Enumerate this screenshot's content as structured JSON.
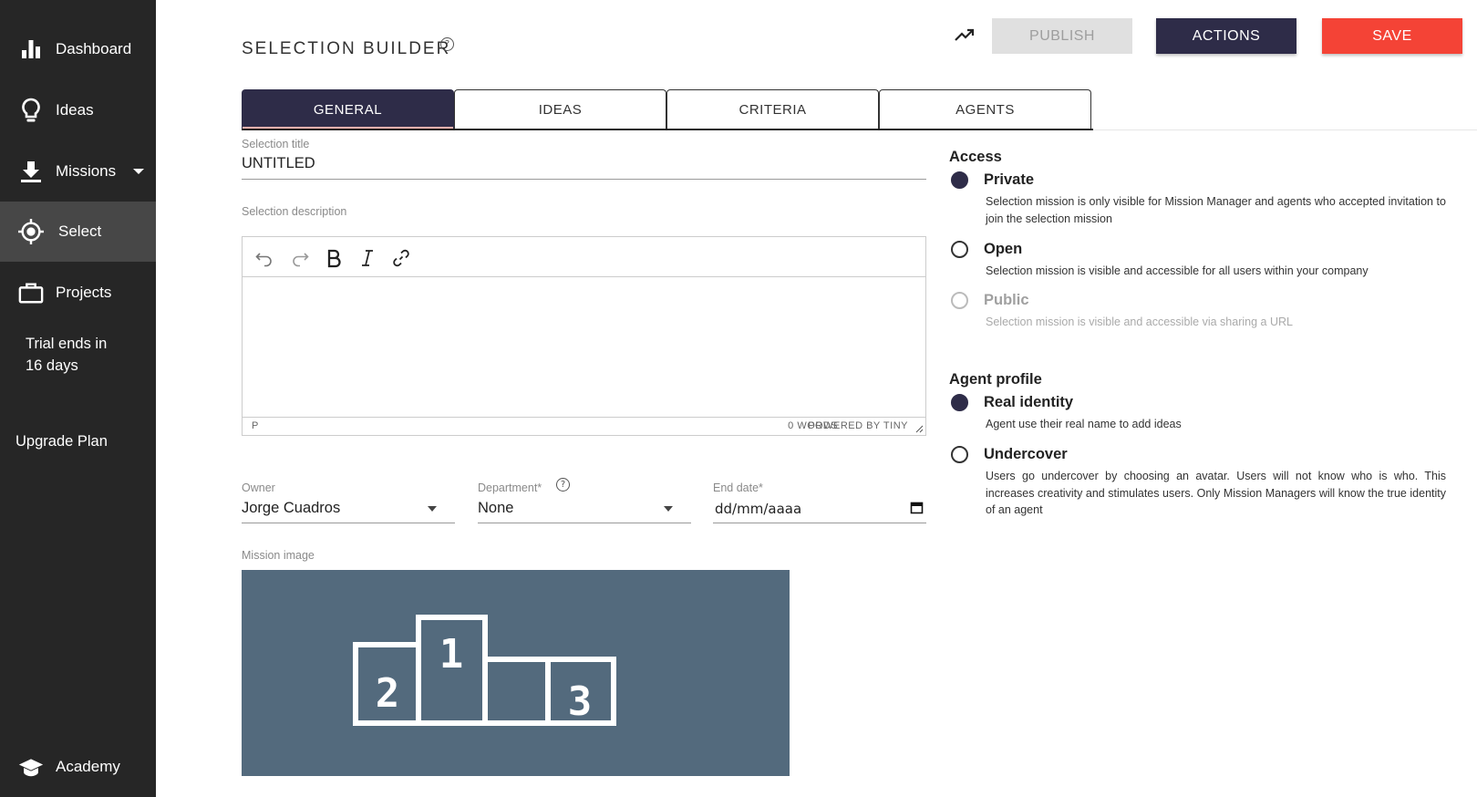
{
  "sidebar": {
    "items": [
      {
        "label": "Dashboard",
        "icon": "bar-chart-icon"
      },
      {
        "label": "Ideas",
        "icon": "lightbulb-icon"
      },
      {
        "label": "Missions",
        "icon": "download-icon"
      },
      {
        "label": "Select",
        "icon": "crosshair-icon"
      },
      {
        "label": "Projects",
        "icon": "briefcase-icon"
      }
    ],
    "trial_line1": "Trial ends in",
    "trial_line2": "16 days",
    "upgrade": "Upgrade Plan",
    "academy": "Academy"
  },
  "header": {
    "title": "SELECTION BUILDER",
    "publish": "PUBLISH",
    "actions": "ACTIONS",
    "save": "SAVE"
  },
  "tabs": [
    "GENERAL",
    "IDEAS",
    "CRITERIA",
    "AGENTS"
  ],
  "form": {
    "title_label": "Selection title",
    "title_value": "UNTITLED",
    "description_label": "Selection description",
    "editor_path": "P",
    "editor_words": "0 WORDS",
    "editor_powered": "POWERED BY TINY",
    "owner_label": "Owner",
    "owner_value": "Jorge Cuadros",
    "department_label": "Department*",
    "department_value": "None",
    "enddate_label": "End date*",
    "enddate_value": "dd/mm/aaaa",
    "image_label": "Mission image"
  },
  "access": {
    "title": "Access",
    "options": [
      {
        "label": "Private",
        "desc": "Selection mission is only visible for Mission Manager and agents who accepted invitation to join the selection mission",
        "checked": true,
        "disabled": false
      },
      {
        "label": "Open",
        "desc": "Selection mission is visible and accessible for all users within your company",
        "checked": false,
        "disabled": false
      },
      {
        "label": "Public",
        "desc": "Selection mission is visible and accessible via sharing a URL",
        "checked": false,
        "disabled": true
      }
    ]
  },
  "agent_profile": {
    "title": "Agent profile",
    "options": [
      {
        "label": "Real identity",
        "desc": "Agent use their real name to add ideas",
        "checked": true
      },
      {
        "label": "Undercover",
        "desc": "Users go undercover by choosing an avatar. Users will not know who is who. This increases creativity and stimulates users. Only Mission Managers will know the true identity of an agent",
        "checked": false
      }
    ]
  },
  "podium": {
    "first": "1",
    "second": "2",
    "third": "3"
  },
  "colors": {
    "sidebar_bg": "#262626",
    "sidebar_active": "#474747",
    "primary_dark": "#2e2c48",
    "save_red": "#f44336",
    "image_bg": "#536a7d"
  }
}
